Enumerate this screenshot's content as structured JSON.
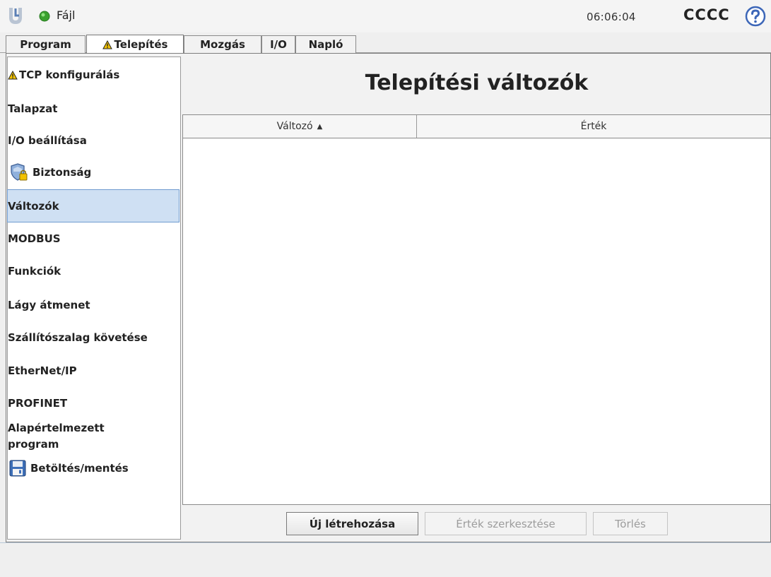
{
  "topbar": {
    "file_menu": "Fájl",
    "clock": "06:06:04",
    "robot_name": "CCCC",
    "status_color": "#3aa12e",
    "logo_icon": "ur-logo-icon",
    "help_icon": "help-icon"
  },
  "tabs": [
    {
      "label": "Program",
      "warning": false
    },
    {
      "label": "Telepítés",
      "warning": true,
      "active": true
    },
    {
      "label": "Mozgás",
      "warning": false
    },
    {
      "label": "I/O",
      "warning": false
    },
    {
      "label": "Napló",
      "warning": false
    }
  ],
  "sidebar": {
    "items": [
      {
        "label": "TCP konfigurálás",
        "icon": "warning-icon"
      },
      {
        "label": "Talapzat"
      },
      {
        "label": "I/O beállítása"
      },
      {
        "label": "Biztonság",
        "icon": "safety-shield-lock-icon"
      },
      {
        "label": "Változók",
        "selected": true
      },
      {
        "label": "MODBUS"
      },
      {
        "label": "Funkciók"
      },
      {
        "label": "Lágy átmenet"
      },
      {
        "label": "Szállítószalag követése"
      },
      {
        "label": "EtherNet/IP"
      },
      {
        "label": "PROFINET"
      },
      {
        "label_line1": "Alapértelmezett",
        "label_line2": "program"
      },
      {
        "label": "Betöltés/mentés",
        "icon": "floppy-disk-icon"
      }
    ]
  },
  "main": {
    "title": "Telepítési változók",
    "table": {
      "columns": [
        "Változó",
        "Érték"
      ],
      "sort_column": "Változó",
      "sort_direction": "ascending",
      "rows": []
    },
    "buttons": {
      "create": "Új létrehozása",
      "edit_value": "Érték szerkesztése",
      "delete": "Törlés"
    }
  },
  "colors": {
    "accent_selected": "#cfe0f3",
    "accent_border": "#6f9bd0",
    "warning": "#f2c200"
  }
}
